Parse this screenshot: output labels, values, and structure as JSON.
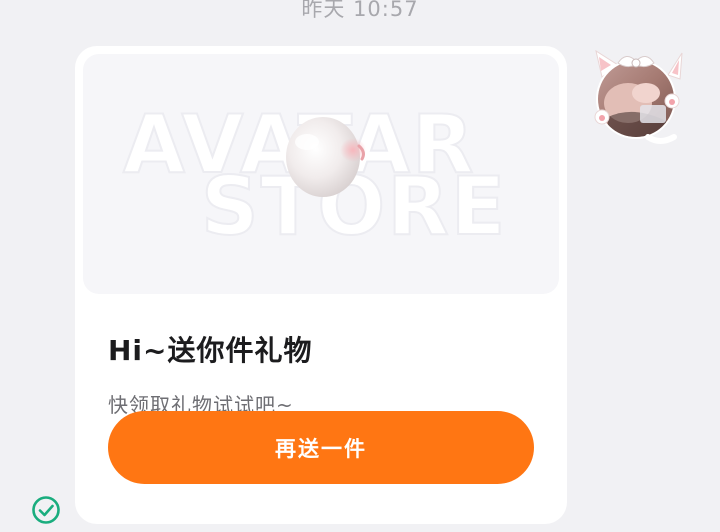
{
  "message": {
    "timestamp": "昨天 10:57",
    "status_icon": "check-circle-icon",
    "status_color": "#1aad7e"
  },
  "gift_card": {
    "banner_words": [
      "AVATAR",
      "STORE"
    ],
    "title": "Hi~送你件礼物",
    "subtitle": "快领取礼物试试吧~",
    "button_label": "再送一件",
    "button_color": "#ff7613"
  },
  "sender": {
    "avatar_icon": "cat-ear-avatar"
  }
}
